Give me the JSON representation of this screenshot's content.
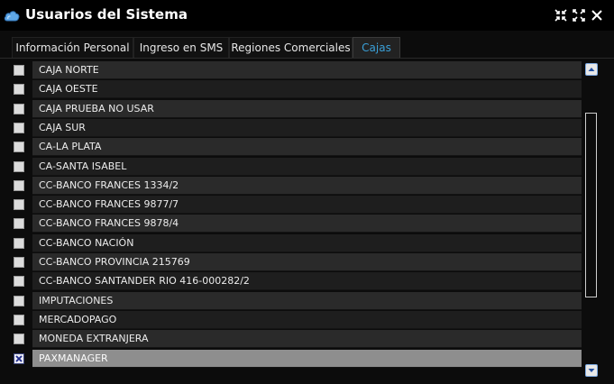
{
  "window": {
    "title": "Usuarios del Sistema",
    "icon": "cloud-icon",
    "controls": [
      "collapse-icon",
      "expand-icon",
      "close-icon"
    ]
  },
  "tabs": [
    {
      "label": "Información Personal",
      "active": false
    },
    {
      "label": "Ingreso en SMS",
      "active": false
    },
    {
      "label": "Regiones Comerciales",
      "active": false
    },
    {
      "label": "Cajas",
      "active": true
    }
  ],
  "cajas": [
    {
      "label": "CAJA NORTE",
      "checked": false
    },
    {
      "label": "CAJA OESTE",
      "checked": false
    },
    {
      "label": "CAJA PRUEBA NO USAR",
      "checked": false
    },
    {
      "label": "CAJA SUR",
      "checked": false
    },
    {
      "label": "CA-LA PLATA",
      "checked": false
    },
    {
      "label": "CA-SANTA ISABEL",
      "checked": false
    },
    {
      "label": "CC-BANCO FRANCES 1334/2",
      "checked": false
    },
    {
      "label": "CC-BANCO FRANCES 9877/7",
      "checked": false
    },
    {
      "label": "CC-BANCO FRANCES 9878/4",
      "checked": false
    },
    {
      "label": "CC-BANCO NACIÓN",
      "checked": false
    },
    {
      "label": "CC-BANCO PROVINCIA 215769",
      "checked": false
    },
    {
      "label": "CC-BANCO SANTANDER RIO 416-000282/2",
      "checked": false
    },
    {
      "label": "IMPUTACIONES",
      "checked": false
    },
    {
      "label": "MERCADOPAGO",
      "checked": false
    },
    {
      "label": "MONEDA EXTRANJERA",
      "checked": false
    },
    {
      "label": "PAXMANAGER",
      "checked": true,
      "selected": true
    }
  ],
  "scrollbar": {
    "position_fraction": 0.35,
    "visible_fraction": 0.65
  },
  "colors": {
    "accent": "#3aa0d8",
    "selected_row": "#8e8e8e",
    "row_dark": "#1e1e1e",
    "row_light": "#2a2a2a"
  }
}
